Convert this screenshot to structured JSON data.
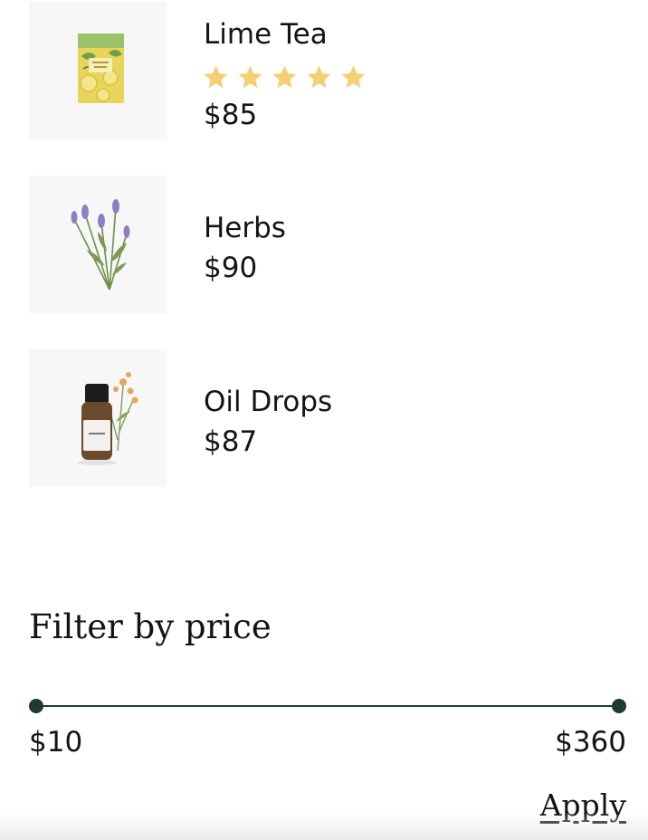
{
  "products": [
    {
      "name": "Lime Tea",
      "price": "$85",
      "rating": 5,
      "image_icon": "lime-tea-box-icon"
    },
    {
      "name": "Herbs",
      "price": "$90",
      "image_icon": "lavender-herbs-icon"
    },
    {
      "name": "Oil Drops",
      "price": "$87",
      "image_icon": "essential-oil-bottle-icon"
    }
  ],
  "filter": {
    "title": "Filter by price",
    "min_label": "$10",
    "max_label": "$360",
    "apply_label": "Apply",
    "track_color": "#1f3a34"
  },
  "colors": {
    "star": "#f6cf72",
    "thumb_background": "#f7f7f7"
  }
}
